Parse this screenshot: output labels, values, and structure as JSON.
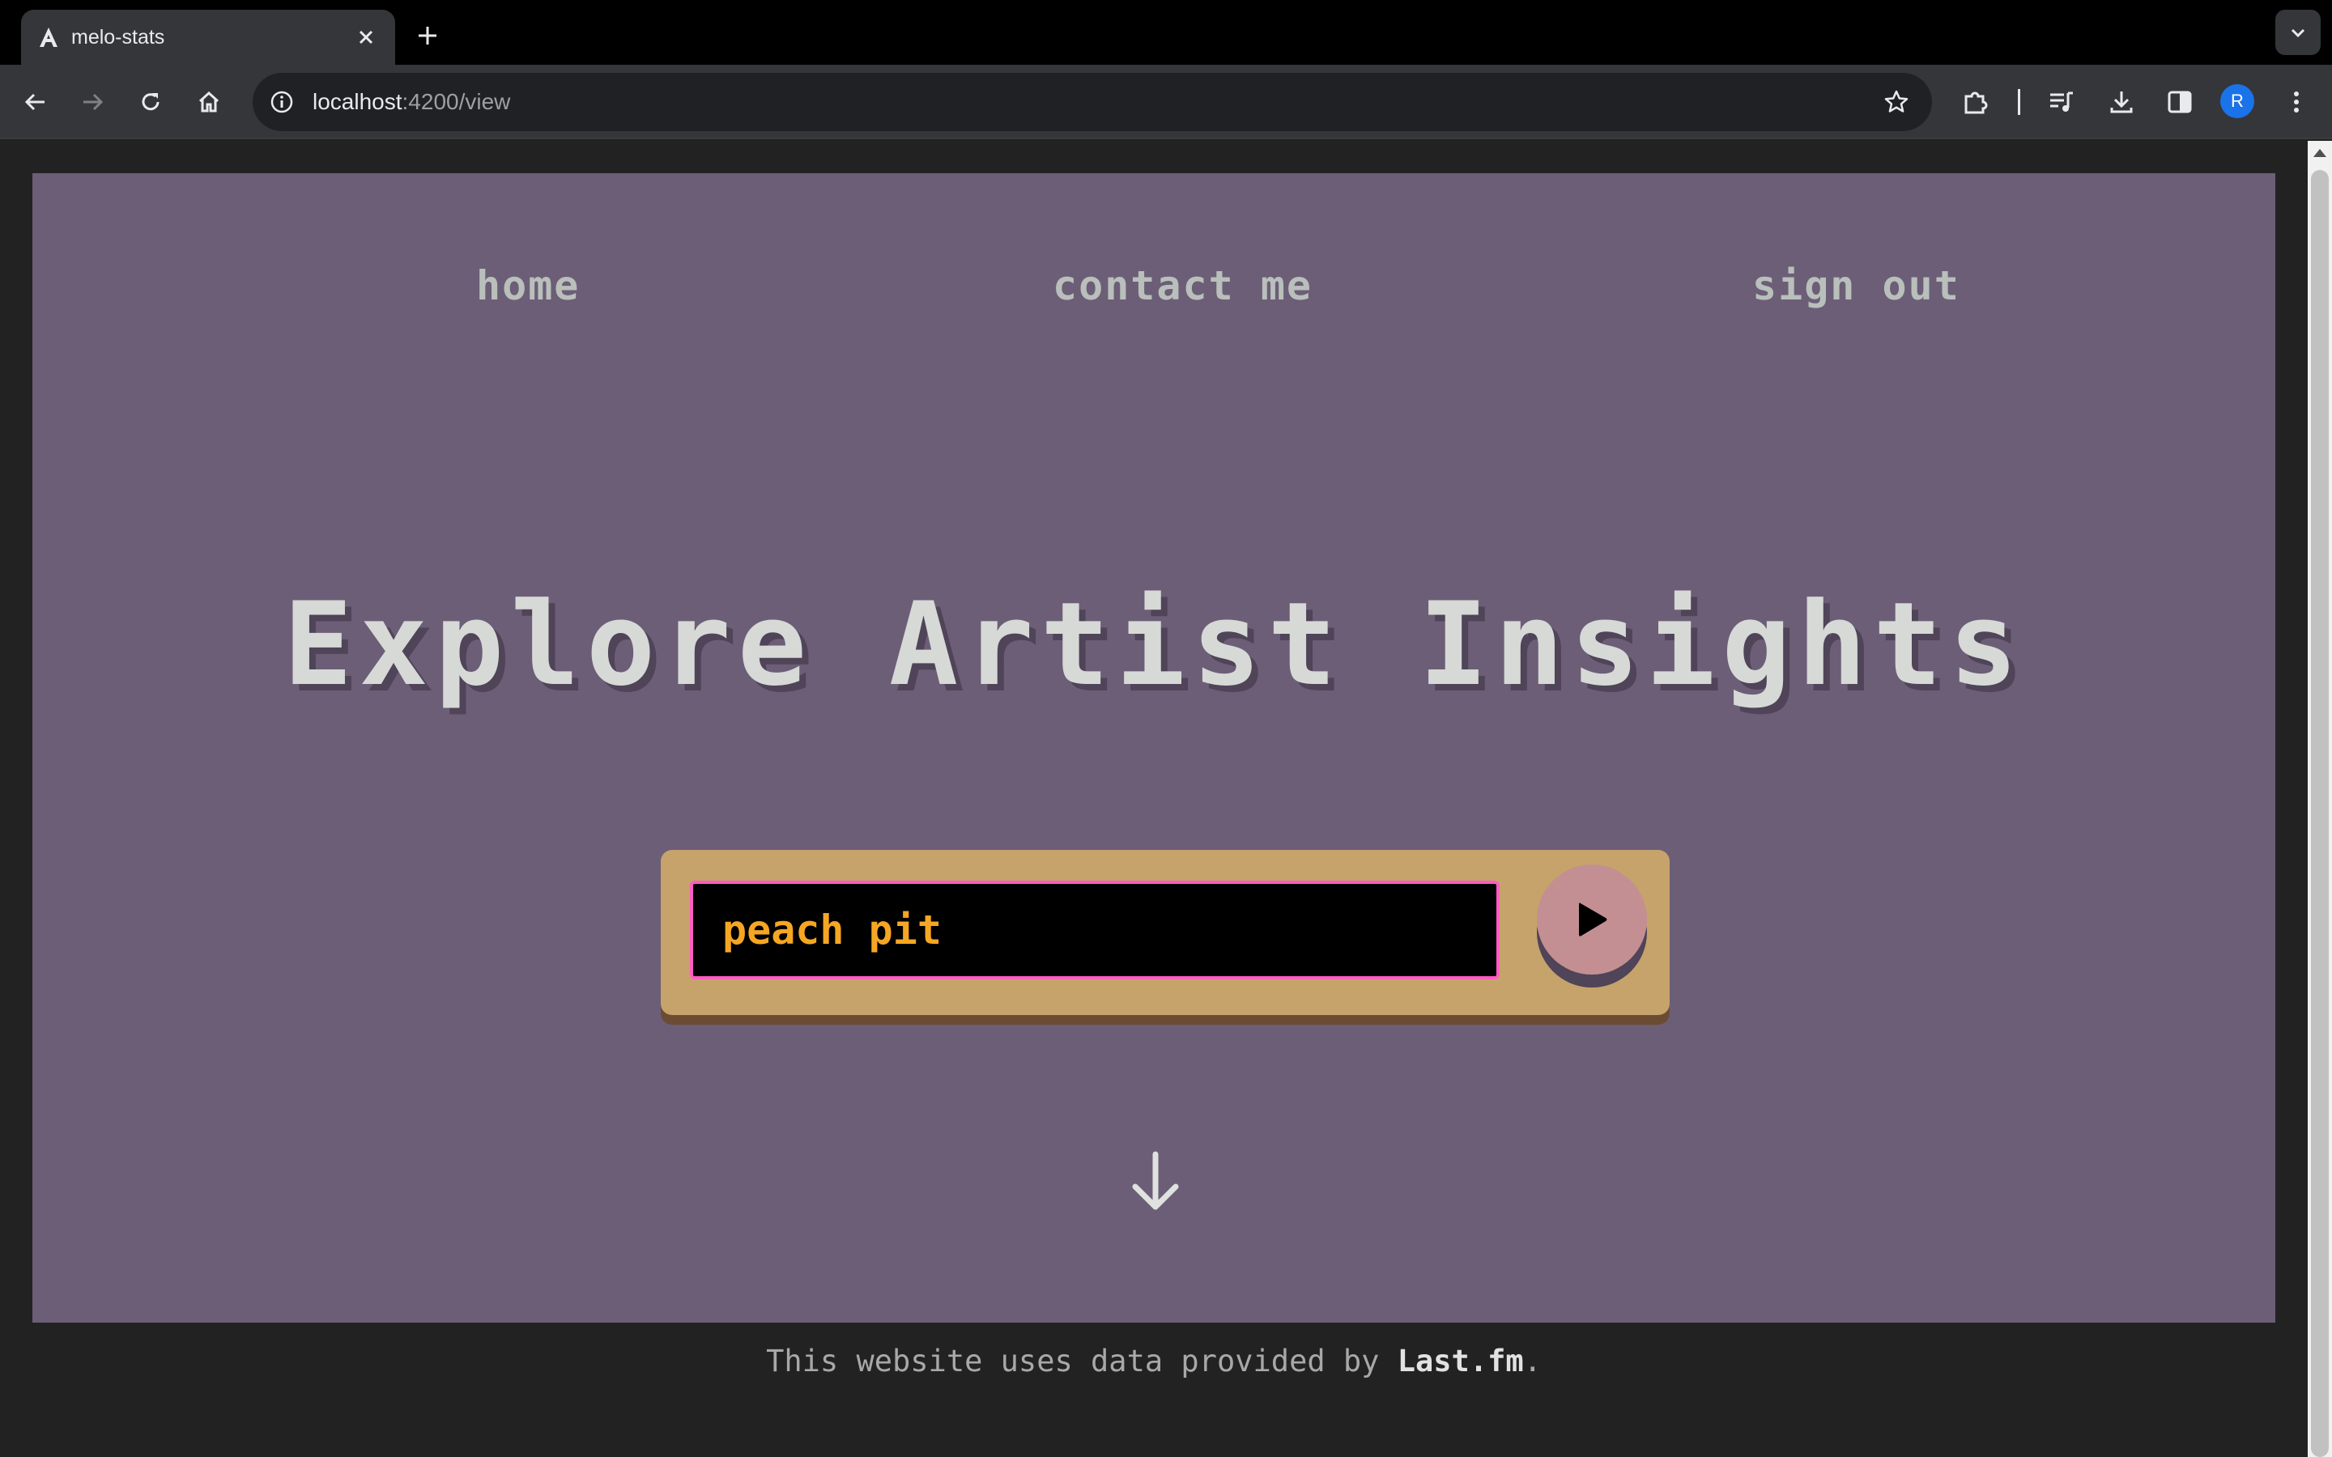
{
  "browser": {
    "tab_title": "melo-stats",
    "url_host": "localhost",
    "url_rest": ":4200/view",
    "profile_initial": "R",
    "icons": [
      "angular-icon",
      "close-icon",
      "plus-icon",
      "chevron-down-icon",
      "back-icon",
      "forward-icon",
      "reload-icon",
      "home-icon",
      "info-icon",
      "star-icon",
      "extensions-icon",
      "media-icon",
      "download-icon",
      "sidepanel-icon",
      "menu-icon"
    ]
  },
  "nav": {
    "home": "home",
    "contact": "contact me",
    "signout": "sign out"
  },
  "hero": {
    "title": "Explore Artist Insights",
    "search_value": "peach pit"
  },
  "footer": {
    "prefix": "This website uses data provided by ",
    "link": "Last.fm",
    "suffix": "."
  },
  "colors": {
    "page_bg": "#222222",
    "hero_bg": "#6c5e77",
    "panel": "#c6a36b",
    "input_text": "#f5a623",
    "input_border": "#ff5cc4",
    "play_button": "#c38f93"
  }
}
